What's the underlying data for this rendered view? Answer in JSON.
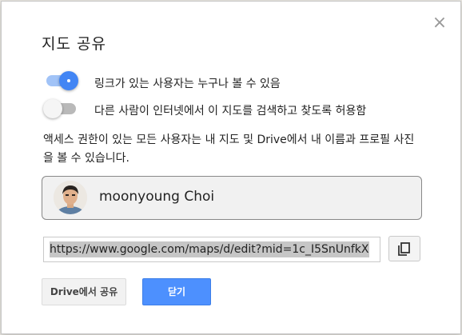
{
  "dialog": {
    "title": "지도 공유",
    "close_icon": "close-icon",
    "close_glyph": "×"
  },
  "toggles": [
    {
      "label": "링크가 있는 사용자는 누구나 볼 수 있음",
      "state": "on"
    },
    {
      "label": "다른 사람이 인터넷에서 이 지도를 검색하고 찾도록 허용함",
      "state": "off"
    }
  ],
  "description": "액세스 권한이 있는 모든 사용자는 내 지도 및 Drive에서 내 이름과 프로필 사진을 볼 수 있습니다.",
  "user": {
    "name": "moonyoung Choi",
    "avatar_icon": "user-avatar"
  },
  "share_link": {
    "value": "https://www.google.com/maps/d/edit?mid=1c_I5SnUnfkX",
    "copy_icon": "copy-icon"
  },
  "buttons": {
    "drive_share": "Drive에서 공유",
    "close": "닫기"
  },
  "colors": {
    "accent": "#4285f4",
    "primary_button": "#4d90fe",
    "toggle_on_track": "#a1c3f7",
    "toggle_off_track": "#b9b9b9"
  }
}
